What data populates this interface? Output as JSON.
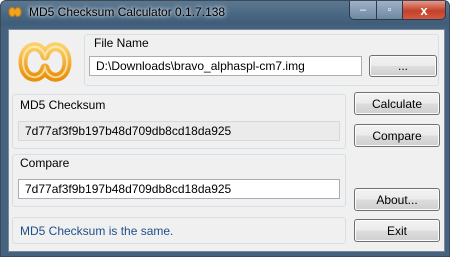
{
  "window": {
    "title": "MD5 Checksum Calculator 0.1.7.138"
  },
  "controls": {
    "minimize": "–",
    "maximize": "▫",
    "close": "x"
  },
  "file": {
    "label": "File Name",
    "value": "D:\\Downloads\\bravo_alphaspl-cm7.img",
    "browse_label": "..."
  },
  "checksum": {
    "label": "MD5 Checksum",
    "value": "7d77af3f9b197b48d709db8cd18da925"
  },
  "compare": {
    "label": "Compare",
    "value": "7d77af3f9b197b48d709db8cd18da925"
  },
  "buttons": {
    "calculate": "Calculate",
    "compare": "Compare",
    "about": "About...",
    "exit": "Exit"
  },
  "status": {
    "text": "MD5 Checksum is the same."
  },
  "colors": {
    "logo": "#f2a21e",
    "status_text": "#1f4e8c"
  }
}
